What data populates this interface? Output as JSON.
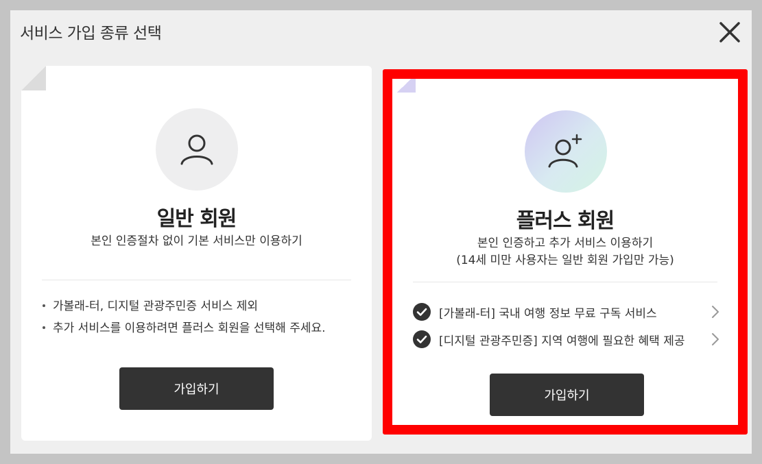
{
  "modal": {
    "title": "서비스 가입 종류 선택"
  },
  "basic": {
    "title": "일반 회원",
    "description": "본인 인증절차 없이 기본 서비스만 이용하기",
    "notes": [
      "가볼래-터, 디지털 관광주민증 서비스 제외",
      "추가 서비스를 이용하려면 플러스 회원을 선택해 주세요."
    ],
    "join_label": "가입하기"
  },
  "plus": {
    "title": "플러스 회원",
    "description_line1": "본인 인증하고 추가 서비스 이용하기",
    "description_line2": "(14세 미만 사용자는 일반 회원 가입만 가능)",
    "benefits": [
      "[가볼래-터] 국내 여행 정보 무료 구독 서비스",
      "[디지털 관광주민증] 지역 여행에 필요한 혜택 제공"
    ],
    "join_label": "가입하기"
  },
  "colors": {
    "selection_border": "#ff0000",
    "button_bg": "#333333"
  },
  "icons": {
    "close": "close-icon",
    "basic_avatar": "user-icon",
    "plus_avatar": "user-plus-icon",
    "benefit_check": "check-circle-icon",
    "benefit_arrow": "chevron-right-icon"
  }
}
